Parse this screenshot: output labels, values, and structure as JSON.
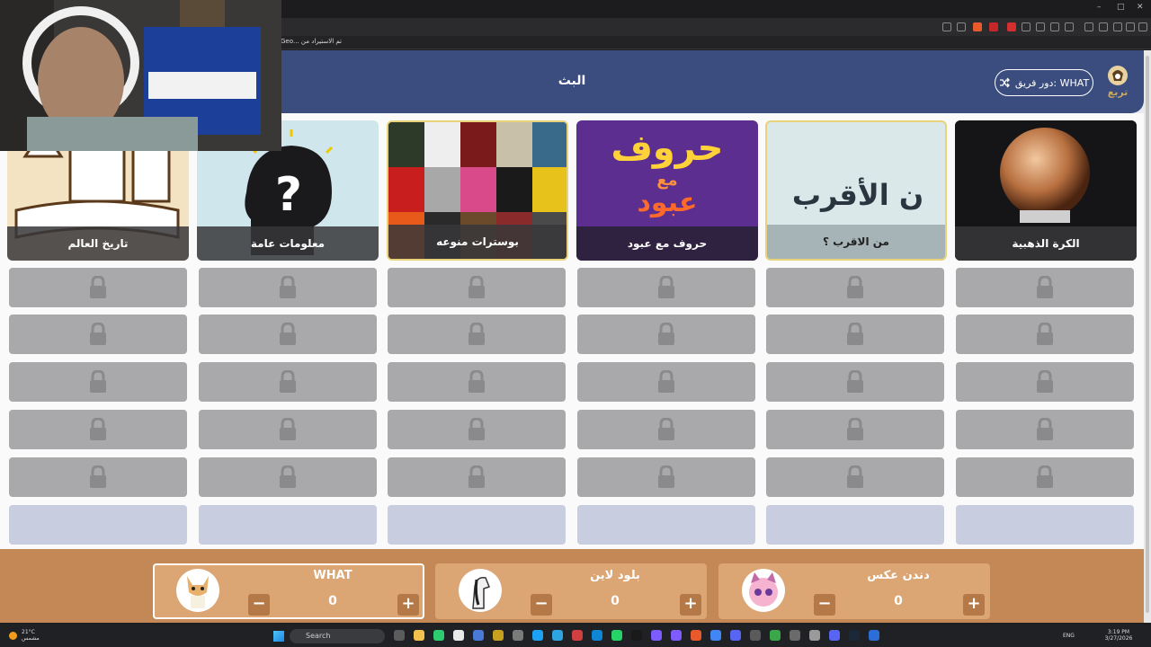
{
  "browser": {
    "bookmark_text": "تم الاستيراد من ...Geo",
    "window_controls": [
      "–",
      "□",
      "✕"
    ]
  },
  "header": {
    "title": "البث",
    "team_button_label": "دور فريق: WHAT",
    "team_button_icon": "shuffle-icon",
    "logo_text": "تربع",
    "accent_color": "#3b4d7e"
  },
  "categories": [
    {
      "label": "الكرة الذهبية",
      "icon": "golden-ball-image"
    },
    {
      "label": "من الاقرب ؟",
      "icon": "closest-text-image"
    },
    {
      "label": "حروف مع عبود",
      "icon": "letters-logo-image"
    },
    {
      "label": "بوسترات منوعه",
      "icon": "posters-collage-image"
    },
    {
      "label": "معلومات عامة",
      "icon": "question-head-image"
    },
    {
      "label": "تاريخ العالم",
      "icon": "world-history-image"
    }
  ],
  "letters_card": {
    "line1": "حروف",
    "line2": "مع",
    "line3": "عبود"
  },
  "closest_card": {
    "text": "ن الأقرب"
  },
  "grid": {
    "locked_rows": 5,
    "empty_rows": 1,
    "columns": 6,
    "lock_icon": "lock-icon"
  },
  "teams": [
    {
      "name": "دندن عكس",
      "score": "0",
      "active": false,
      "avatar": "pink-cat-avatar-icon"
    },
    {
      "name": "بلود لاين",
      "score": "0",
      "active": false,
      "avatar": "horse-avatar-icon"
    },
    {
      "name": "WHAT",
      "score": "0",
      "active": true,
      "avatar": "fox-avatar-icon"
    }
  ],
  "controls": {
    "minus": "−",
    "plus": "+"
  },
  "taskbar": {
    "search_label": "Search",
    "weather": "21°C",
    "weather_sub": "مشمس",
    "lang": "ENG",
    "time": "3:19 PM",
    "date": "3/27/2026"
  },
  "colors": {
    "footer": "#c48756",
    "team_card": "#dba574",
    "locked_cell": "#a9a9ab",
    "empty_cell": "#c8cde0"
  }
}
